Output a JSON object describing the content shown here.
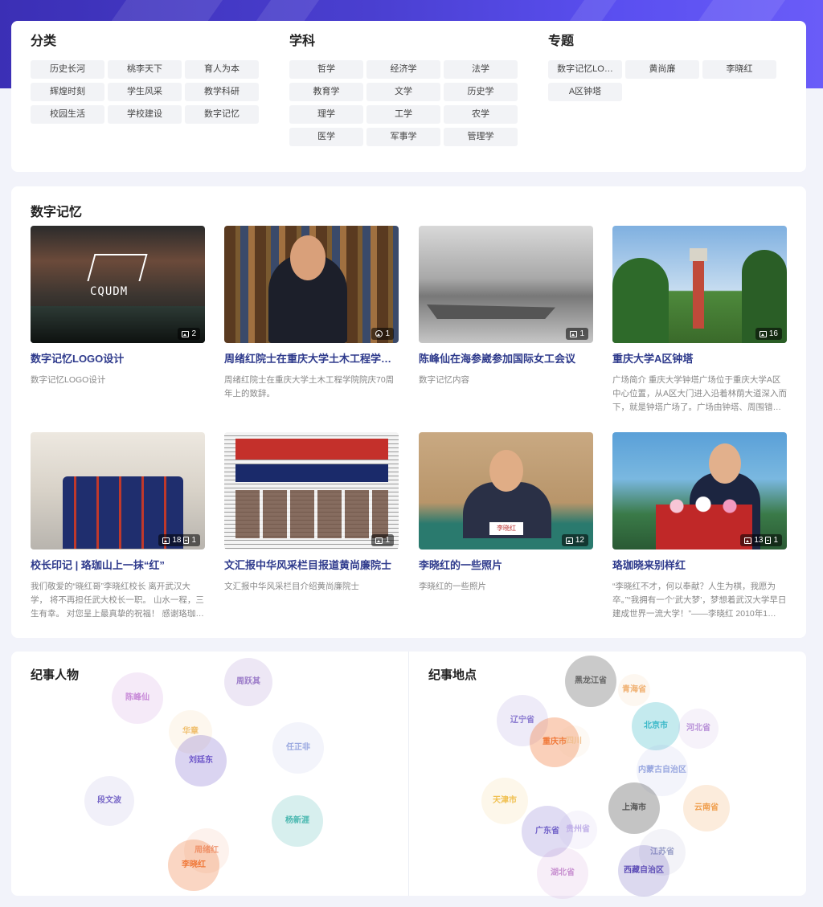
{
  "filters": {
    "categories": {
      "title": "分类",
      "items": [
        "历史长河",
        "桃李天下",
        "育人为本",
        "辉煌时刻",
        "学生风采",
        "教学科研",
        "校园生活",
        "学校建设",
        "数字记忆"
      ]
    },
    "disciplines": {
      "title": "学科",
      "items": [
        "哲学",
        "经济学",
        "法学",
        "教育学",
        "文学",
        "历史学",
        "理学",
        "工学",
        "农学",
        "医学",
        "军事学",
        "管理学"
      ]
    },
    "topics": {
      "title": "专题",
      "items": [
        "数字记忆LO…",
        "黄尚廉",
        "李晓红",
        "A区钟塔"
      ]
    }
  },
  "memory": {
    "title": "数字记忆",
    "items": [
      {
        "title": "数字记忆LOGO设计",
        "desc": "数字记忆LOGO设计",
        "img_count": "2",
        "doc_count": "",
        "image_text": "CQUDM",
        "icon": "image-icon"
      },
      {
        "title": "周绪红院士在重庆大学土木工程学…",
        "desc": "周绪红院士在重庆大学土木工程学院院庆70周年上的致辞。",
        "img_count": "",
        "doc_count": "1",
        "icon": "video-icon"
      },
      {
        "title": "陈峰仙在海参崴参加国际女工会议",
        "desc": "数字记忆内容",
        "img_count": "1",
        "doc_count": "",
        "icon": "image-icon"
      },
      {
        "title": "重庆大学A区钟塔",
        "desc": "广场简介 重庆大学钟塔广场位于重庆大学A区中心位置，从A区大门进入沿着林荫大道深入而下，就是钟塔广场了。广场由钟塔、周围错…",
        "img_count": "16",
        "doc_count": "",
        "icon": "image-icon"
      },
      {
        "title": "校长印记 | 珞珈山上一抹“红”",
        "desc": "我们敬爱的“晓红哥”李晓红校长 离开武汉大学， 将不再担任武大校长一职。 山水一程，三生有幸。 对您呈上最真挚的祝福！ 感谢珞珈…",
        "img_count": "18",
        "doc_count": "1",
        "icon": "image-icon"
      },
      {
        "title": "文汇报中华风采栏目报道黄尚廉院士",
        "desc": "文汇报中华风采栏目介绍黄尚廉院士",
        "img_count": "1",
        "doc_count": "",
        "icon": "image-icon"
      },
      {
        "title": "李晓红的一些照片",
        "desc": "李晓红的一些照片",
        "img_count": "12",
        "doc_count": "",
        "image_text": "李晓红",
        "icon": "image-icon"
      },
      {
        "title": "珞珈晓来别样红",
        "desc": "“李晓红不才，何以奉献？人生为棋，我愿为卒。”“我拥有一个‘武大梦’，梦想着武汉大学早日建成世界一流大学！”——李晓红 2010年1…",
        "img_count": "13",
        "doc_count": "1",
        "icon": "image-icon"
      }
    ]
  },
  "people": {
    "title": "纪事人物",
    "bubbles": [
      {
        "label": "陈峰仙",
        "color": "#c88ad8"
      },
      {
        "label": "周跃其",
        "color": "#9a7ac8"
      },
      {
        "label": "华章",
        "color": "#f0c070"
      },
      {
        "label": "刘廷东",
        "color": "#6a52c8"
      },
      {
        "label": "任正非",
        "color": "#9aa8e0"
      },
      {
        "label": "段文波",
        "color": "#7a6ac8"
      },
      {
        "label": "杨新涯",
        "color": "#4ab8b0"
      },
      {
        "label": "周绪红",
        "color": "#f0a080"
      },
      {
        "label": "李晓红",
        "color": "#f07838"
      }
    ]
  },
  "places": {
    "title": "纪事地点",
    "bubbles": [
      {
        "label": "黑龙江省",
        "color": "#666666"
      },
      {
        "label": "青海省",
        "color": "#f0b070"
      },
      {
        "label": "辽宁省",
        "color": "#8a7ad0"
      },
      {
        "label": "北京市",
        "color": "#3ab8c8"
      },
      {
        "label": "河北省",
        "color": "#b890d8"
      },
      {
        "label": "重庆市",
        "color": "#f07838"
      },
      {
        "label": "四川",
        "color": "#f0c090"
      },
      {
        "label": "内蒙古自治区",
        "color": "#9aa8e0"
      },
      {
        "label": "天津市",
        "color": "#f0c050"
      },
      {
        "label": "上海市",
        "color": "#555555"
      },
      {
        "label": "云南省",
        "color": "#f0a050"
      },
      {
        "label": "广东省",
        "color": "#7060c8"
      },
      {
        "label": "贵州省",
        "color": "#c0b0e8"
      },
      {
        "label": "江苏省",
        "color": "#9aa0c8"
      },
      {
        "label": "湖北省",
        "color": "#c890d0"
      },
      {
        "label": "西藏自治区",
        "color": "#6050b8"
      }
    ]
  }
}
